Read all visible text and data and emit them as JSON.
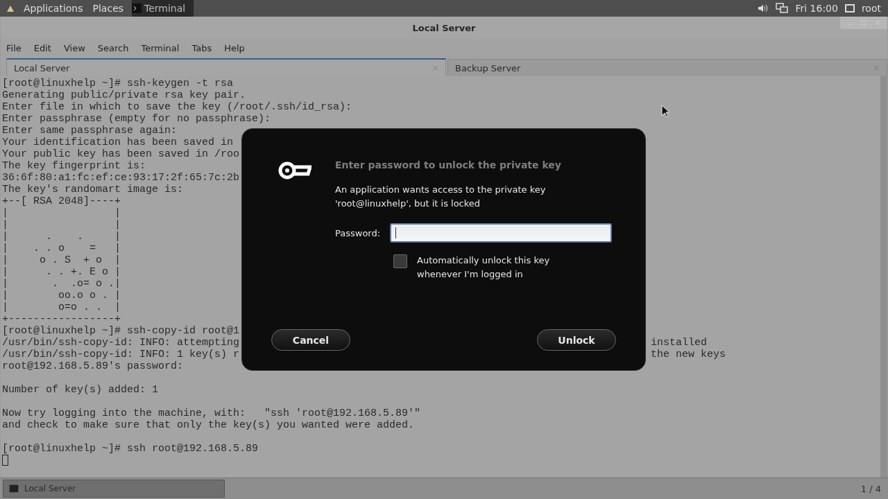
{
  "top_panel": {
    "menus": [
      "Applications",
      "Places"
    ],
    "task": "Terminal",
    "clock": "Fri 16:00",
    "user": "root"
  },
  "window": {
    "title": "Local Server"
  },
  "menu_bar": [
    "File",
    "Edit",
    "View",
    "Search",
    "Terminal",
    "Tabs",
    "Help"
  ],
  "tabs": [
    {
      "label": "Local Server",
      "selected": true
    },
    {
      "label": "Backup Server",
      "selected": false
    }
  ],
  "terminal_blocks": [
    {
      "lines": [
        {
          "text": "[root@linuxhelp ~]# ssh-keygen -t rsa"
        },
        {
          "text": "Generating public/private rsa key pair."
        },
        {
          "text": "Enter file in which to save the key (/root/.ssh/id_rsa):"
        },
        {
          "text": "Enter passphrase (empty for no passphrase):"
        },
        {
          "text": "Enter same passphrase again:"
        },
        {
          "text": "Your identification has been saved in"
        },
        {
          "text": "Your public key has been saved in /roo"
        },
        {
          "text": "The key fingerprint is:"
        },
        {
          "text": "36:6f:80:a1:fc:ef:ce:93:17:2f:65:7c:2b"
        },
        {
          "text": "The key's randomart image is:"
        },
        {
          "text": "+--[ RSA 2048]----+"
        },
        {
          "text": "|                 |"
        },
        {
          "text": "|                 |"
        },
        {
          "text": "|      .    .     |"
        },
        {
          "text": "|    . . o    =   |"
        },
        {
          "text": "|     o . S  + o  |"
        },
        {
          "text": "|      . . +. E o |"
        },
        {
          "text": "|       .  .o= o .|"
        },
        {
          "text": "|        oo.o o . |"
        },
        {
          "text": "|        o=o . .  |"
        },
        {
          "text": "+-----------------+"
        },
        {
          "text": "[root@linuxhelp ~]# ssh-copy-id root@1"
        },
        {
          "text": "/usr/bin/ssh-copy-id: INFO: attempting",
          "tail": "installed"
        },
        {
          "text": "/usr/bin/ssh-copy-id: INFO: 1 key(s) r",
          "tail": "the new keys"
        },
        {
          "text": "root@192.168.5.89's password:"
        }
      ]
    },
    {
      "lines": [
        {
          "text": "Number of key(s) added: 1"
        }
      ]
    },
    {
      "lines": [
        {
          "text": "Now try logging into the machine, with:   \"ssh 'root@192.168.5.89'\""
        },
        {
          "text": "and check to make sure that only the key(s) you wanted were added."
        }
      ]
    },
    {
      "lines": [
        {
          "text": "[root@linuxhelp ~]# ssh root@192.168.5.89"
        }
      ]
    }
  ],
  "dialog": {
    "title": "Enter password to unlock the private key",
    "message": "An application wants access to the private key 'root@linuxhelp', but it is locked",
    "password_label": "Password:",
    "auto_unlock": {
      "label": "Automatically unlock this key whenever I'm logged in",
      "checked": false
    },
    "buttons": [
      "Cancel",
      "Unlock"
    ]
  },
  "taskbar": {
    "task": "Local Server",
    "workspace": "1 / 4"
  }
}
